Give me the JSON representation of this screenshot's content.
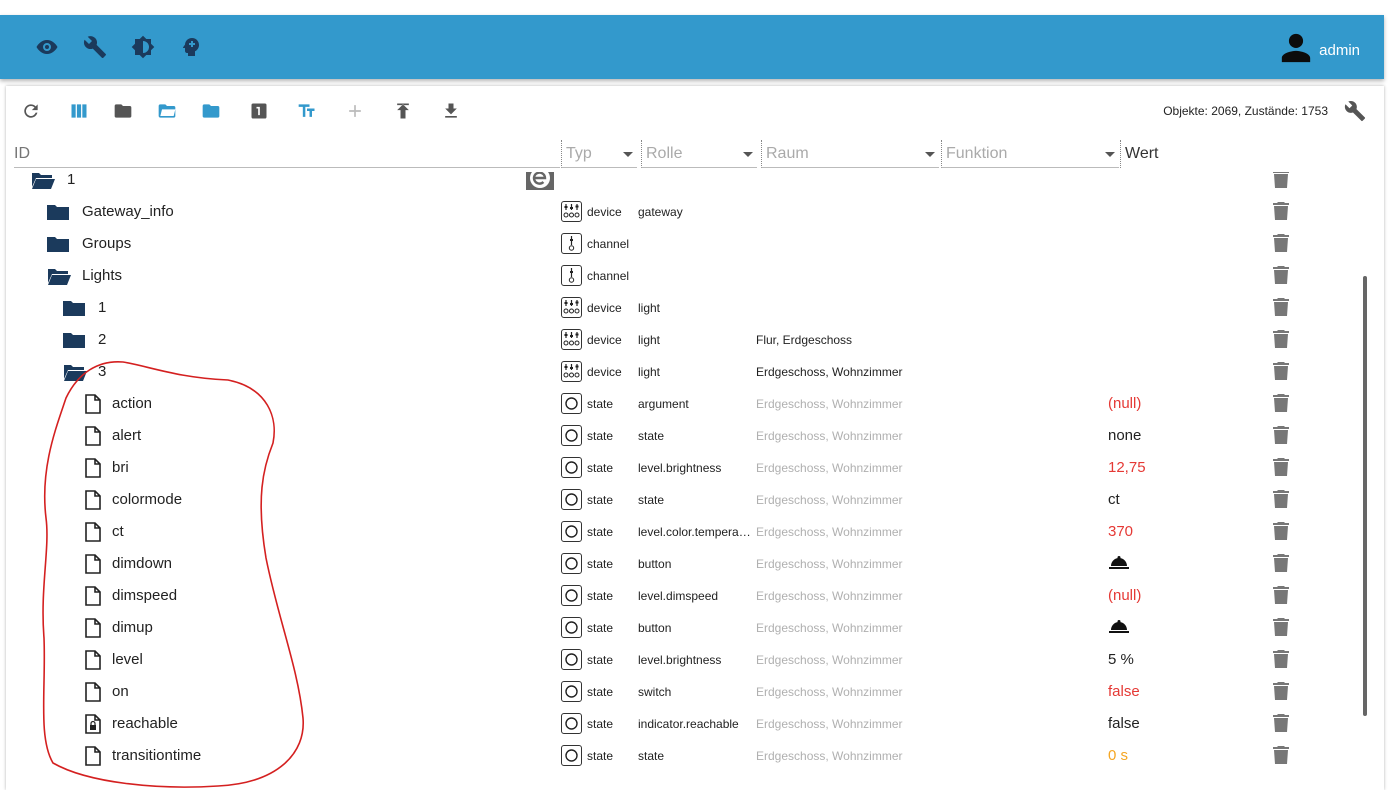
{
  "header": {
    "user_name": "admin",
    "nav_icons": [
      "eye-icon",
      "wrench-icon",
      "brightness-icon",
      "head-icon"
    ],
    "accent": "#3399cc"
  },
  "toolbar": {
    "stats": "Objekte: 2069, Zustände: 1753",
    "icons": [
      "refresh-icon",
      "columns-icon",
      "folder-icon",
      "folder-open-icon",
      "folder-blue-icon",
      "one-icon",
      "text-size-icon",
      "plus-icon",
      "upload-icon",
      "download-icon"
    ]
  },
  "filters": {
    "id_placeholder": "ID",
    "typ": "Typ",
    "rolle": "Rolle",
    "raum": "Raum",
    "funktion": "Funktion",
    "wert": "Wert"
  },
  "rows": [
    {
      "name": "1",
      "icon": "folder-open",
      "typ": "",
      "rolle": "",
      "raum": "",
      "wert": "",
      "typ_icon": ""
    },
    {
      "name": "Gateway_info",
      "icon": "folder",
      "typ": "device",
      "rolle": "gateway",
      "raum": "",
      "wert": "",
      "typ_icon": "device"
    },
    {
      "name": "Groups",
      "icon": "folder",
      "typ": "channel",
      "rolle": "",
      "raum": "",
      "wert": "",
      "typ_icon": "channel"
    },
    {
      "name": "Lights",
      "icon": "folder-open",
      "typ": "channel",
      "rolle": "",
      "raum": "",
      "wert": "",
      "typ_icon": "channel"
    },
    {
      "name": "1",
      "icon": "folder",
      "typ": "device",
      "rolle": "light",
      "raum": "",
      "wert": "",
      "typ_icon": "device"
    },
    {
      "name": "2",
      "icon": "folder",
      "typ": "device",
      "rolle": "light",
      "raum": "Flur, Erdgeschoss",
      "wert": "",
      "typ_icon": "device"
    },
    {
      "name": "3",
      "icon": "folder-open",
      "typ": "device",
      "rolle": "light",
      "raum": "Erdgeschoss, Wohnzimmer",
      "wert": "",
      "typ_icon": "device"
    },
    {
      "name": "action",
      "icon": "file",
      "typ": "state",
      "rolle": "argument",
      "raum": "Erdgeschoss, Wohnzimmer",
      "wert": "(null)",
      "typ_icon": "state"
    },
    {
      "name": "alert",
      "icon": "file",
      "typ": "state",
      "rolle": "state",
      "raum": "Erdgeschoss, Wohnzimmer",
      "wert": "none",
      "typ_icon": "state"
    },
    {
      "name": "bri",
      "icon": "file",
      "typ": "state",
      "rolle": "level.brightness",
      "raum": "Erdgeschoss, Wohnzimmer",
      "wert": "12,75",
      "typ_icon": "state"
    },
    {
      "name": "colormode",
      "icon": "file",
      "typ": "state",
      "rolle": "state",
      "raum": "Erdgeschoss, Wohnzimmer",
      "wert": "ct",
      "typ_icon": "state"
    },
    {
      "name": "ct",
      "icon": "file",
      "typ": "state",
      "rolle": "level.color.temperat...",
      "raum": "Erdgeschoss, Wohnzimmer",
      "wert": "370",
      "typ_icon": "state"
    },
    {
      "name": "dimdown",
      "icon": "file",
      "typ": "state",
      "rolle": "button",
      "raum": "Erdgeschoss, Wohnzimmer",
      "wert": "",
      "typ_icon": "state"
    },
    {
      "name": "dimspeed",
      "icon": "file",
      "typ": "state",
      "rolle": "level.dimspeed",
      "raum": "Erdgeschoss, Wohnzimmer",
      "wert": "(null)",
      "typ_icon": "state"
    },
    {
      "name": "dimup",
      "icon": "file",
      "typ": "state",
      "rolle": "button",
      "raum": "Erdgeschoss, Wohnzimmer",
      "wert": "",
      "typ_icon": "state"
    },
    {
      "name": "level",
      "icon": "file",
      "typ": "state",
      "rolle": "level.brightness",
      "raum": "Erdgeschoss, Wohnzimmer",
      "wert": "5 %",
      "typ_icon": "state"
    },
    {
      "name": "on",
      "icon": "file",
      "typ": "state",
      "rolle": "switch",
      "raum": "Erdgeschoss, Wohnzimmer",
      "wert": "false",
      "typ_icon": "state"
    },
    {
      "name": "reachable",
      "icon": "file-lock",
      "typ": "state",
      "rolle": "indicator.reachable",
      "raum": "Erdgeschoss, Wohnzimmer",
      "wert": "false",
      "typ_icon": "state"
    },
    {
      "name": "transitiontime",
      "icon": "file",
      "typ": "state",
      "rolle": "state",
      "raum": "Erdgeschoss, Wohnzimmer",
      "wert": "0 s",
      "typ_icon": "state"
    }
  ]
}
